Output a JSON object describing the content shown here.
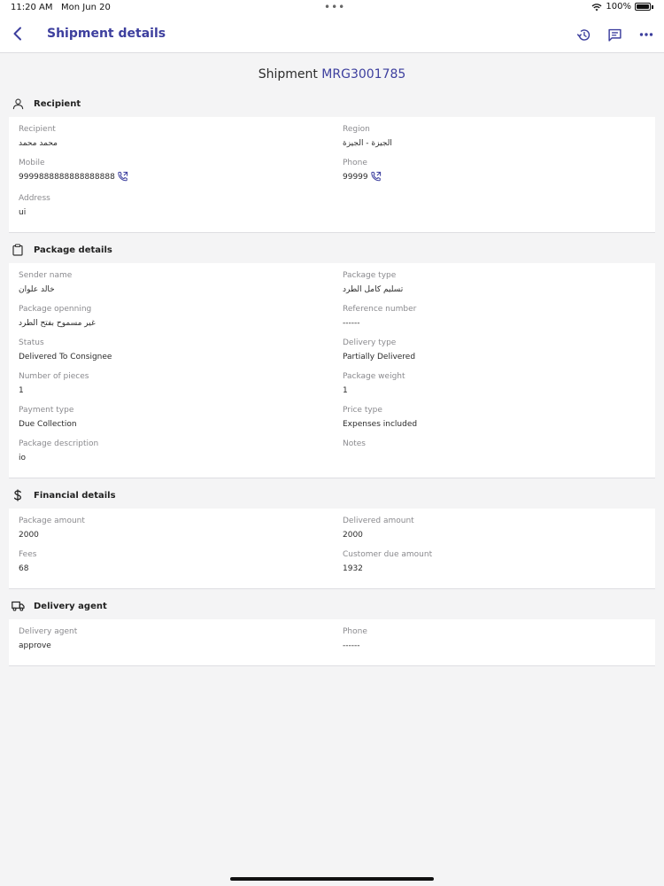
{
  "status_bar": {
    "time": "11:20 AM",
    "date": "Mon Jun 20",
    "battery": "100%"
  },
  "navbar": {
    "title": "Shipment details"
  },
  "heading": {
    "prefix": "Shipment",
    "shipment_id": "MRG3001785"
  },
  "recipient": {
    "title": "Recipient",
    "fields": [
      {
        "label": "Recipient",
        "value": "محمد محمد"
      },
      {
        "label": "Region",
        "value": "الجيزة - الجيزة"
      },
      {
        "label": "Mobile",
        "value": "9999888888888888888"
      },
      {
        "label": "Phone",
        "value": "99999"
      },
      {
        "label": "Address",
        "value": "ui"
      }
    ]
  },
  "package": {
    "title": "Package details",
    "fields": [
      {
        "label": "Sender name",
        "value": "خالد علوان"
      },
      {
        "label": "Package type",
        "value": "تسليم كامل الطرد"
      },
      {
        "label": "Package openning",
        "value": "غير مسموح بفتح الطرد"
      },
      {
        "label": "Reference number",
        "value": "------"
      },
      {
        "label": "Status",
        "value": "Delivered To Consignee"
      },
      {
        "label": "Delivery type",
        "value": "Partially Delivered"
      },
      {
        "label": "Number of pieces",
        "value": "1"
      },
      {
        "label": "Package weight",
        "value": "1"
      },
      {
        "label": "Payment type",
        "value": "Due Collection"
      },
      {
        "label": "Price type",
        "value": "Expenses included"
      },
      {
        "label": "Package description",
        "value": "io"
      },
      {
        "label": "Notes",
        "value": ""
      }
    ]
  },
  "financial": {
    "title": "Financial details",
    "fields": [
      {
        "label": "Package amount",
        "value": "2000"
      },
      {
        "label": "Delivered amount",
        "value": "2000"
      },
      {
        "label": "Fees",
        "value": "68"
      },
      {
        "label": "Customer due amount",
        "value": "1932"
      }
    ]
  },
  "agent": {
    "title": "Delivery agent",
    "fields": [
      {
        "label": "Delivery agent",
        "value": "approve"
      },
      {
        "label": "Phone",
        "value": "------"
      }
    ]
  },
  "colors": {
    "accent": "#3d3f9e",
    "label": "#8a8a8e",
    "background": "#f4f4f5"
  }
}
